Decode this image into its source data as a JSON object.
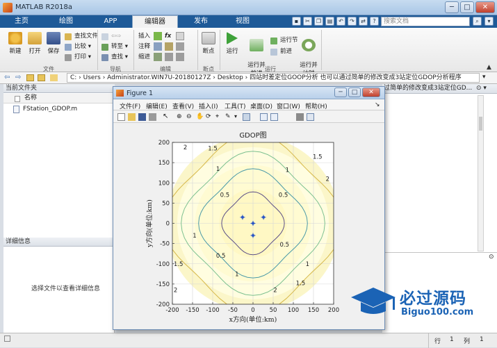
{
  "window": {
    "title": "MATLAB R2018a",
    "buttons": [
      "─",
      "□",
      "✕"
    ]
  },
  "tabs": [
    {
      "label": "主页",
      "active": false
    },
    {
      "label": "绘图",
      "active": false
    },
    {
      "label": "APP",
      "active": false
    },
    {
      "label": "编辑器",
      "active": true
    },
    {
      "label": "发布",
      "active": false
    },
    {
      "label": "视图",
      "active": false
    }
  ],
  "search": {
    "placeholder": "搜索文档"
  },
  "ribbon": {
    "file": {
      "new": "新建",
      "open": "打开",
      "save": "保存",
      "find_files": "查找文件",
      "compare": "比较",
      "print": "打印",
      "group": "文件"
    },
    "nav": {
      "goto": "转至",
      "find": "查找",
      "group": "导航"
    },
    "edit": {
      "insert": "插入",
      "comment": "注释",
      "indent": "缩进",
      "fx": "fx",
      "group": "编辑"
    },
    "breakpoints": {
      "label": "断点",
      "group": "断点"
    },
    "run": {
      "run": "运行",
      "run_advance": "运行并\n前进",
      "run_section": "运行节",
      "advance": "前进",
      "run_time": "运行并\n计时",
      "group": "运行"
    }
  },
  "address": {
    "path": "C: › Users › Administrator.WIN7U-20180127Z › Desktop › 四站时差定位GOOP分析 也可以通过简单的修改变成3站定位GDOP分析程序"
  },
  "left_pane": {
    "title": "当前文件夹",
    "column": "名称",
    "file": "FStation_GDOP.m",
    "details_title": "详细信息",
    "details_hint": "选择文件以查看详细信息"
  },
  "right_pane": {
    "header_text": "过简单的修改变成3站定位GD..."
  },
  "status": {
    "row_label": "行",
    "row": "1",
    "col_label": "列",
    "col": "1"
  },
  "figure": {
    "title": "Figure 1",
    "menus": [
      "文件(F)",
      "编辑(E)",
      "查看(V)",
      "插入(I)",
      "工具(T)",
      "桌面(D)",
      "窗口(W)",
      "帮助(H)"
    ]
  },
  "chart_data": {
    "type": "contour",
    "title": "GDOP图",
    "xlabel": "x方向(单位:km)",
    "ylabel": "y方向(单位:km)",
    "xlim": [
      -200,
      200
    ],
    "ylim": [
      -200,
      200
    ],
    "xticks": [
      -200,
      -150,
      -100,
      -50,
      0,
      50,
      100,
      150,
      200
    ],
    "yticks": [
      -200,
      -150,
      -100,
      -50,
      0,
      50,
      100,
      150,
      200
    ],
    "grid": true,
    "levels": [
      0.5,
      1,
      1.5,
      2
    ],
    "level_colors": [
      "#5a4e87",
      "#4a9aa8",
      "#7bc08f",
      "#d6b84a"
    ],
    "stations": [
      {
        "x": 0,
        "y": 0
      },
      {
        "x": -26,
        "y": 15
      },
      {
        "x": 26,
        "y": 15
      },
      {
        "x": 0,
        "y": -30
      }
    ],
    "contour_labels": [
      {
        "text": "2",
        "x": -168,
        "y": 188
      },
      {
        "text": "1.5",
        "x": -100,
        "y": 185
      },
      {
        "text": "1",
        "x": -87,
        "y": 135
      },
      {
        "text": "0.5",
        "x": -70,
        "y": 70
      },
      {
        "text": "0.5",
        "x": 75,
        "y": 70
      },
      {
        "text": "1",
        "x": 85,
        "y": 132
      },
      {
        "text": "1.5",
        "x": 160,
        "y": 165
      },
      {
        "text": "2",
        "x": 185,
        "y": 110
      },
      {
        "text": "1",
        "x": -145,
        "y": -30
      },
      {
        "text": "1.5",
        "x": -185,
        "y": -100
      },
      {
        "text": "2",
        "x": -192,
        "y": -165
      },
      {
        "text": "0.5",
        "x": -80,
        "y": -80
      },
      {
        "text": "1",
        "x": -40,
        "y": -125
      },
      {
        "text": "0.5",
        "x": 78,
        "y": -52
      },
      {
        "text": "1",
        "x": 135,
        "y": -100
      },
      {
        "text": "1.5",
        "x": 118,
        "y": -148
      },
      {
        "text": "2",
        "x": 55,
        "y": -165
      }
    ]
  },
  "watermark": {
    "brand": "必过源码",
    "url": "Biguo100.com"
  }
}
